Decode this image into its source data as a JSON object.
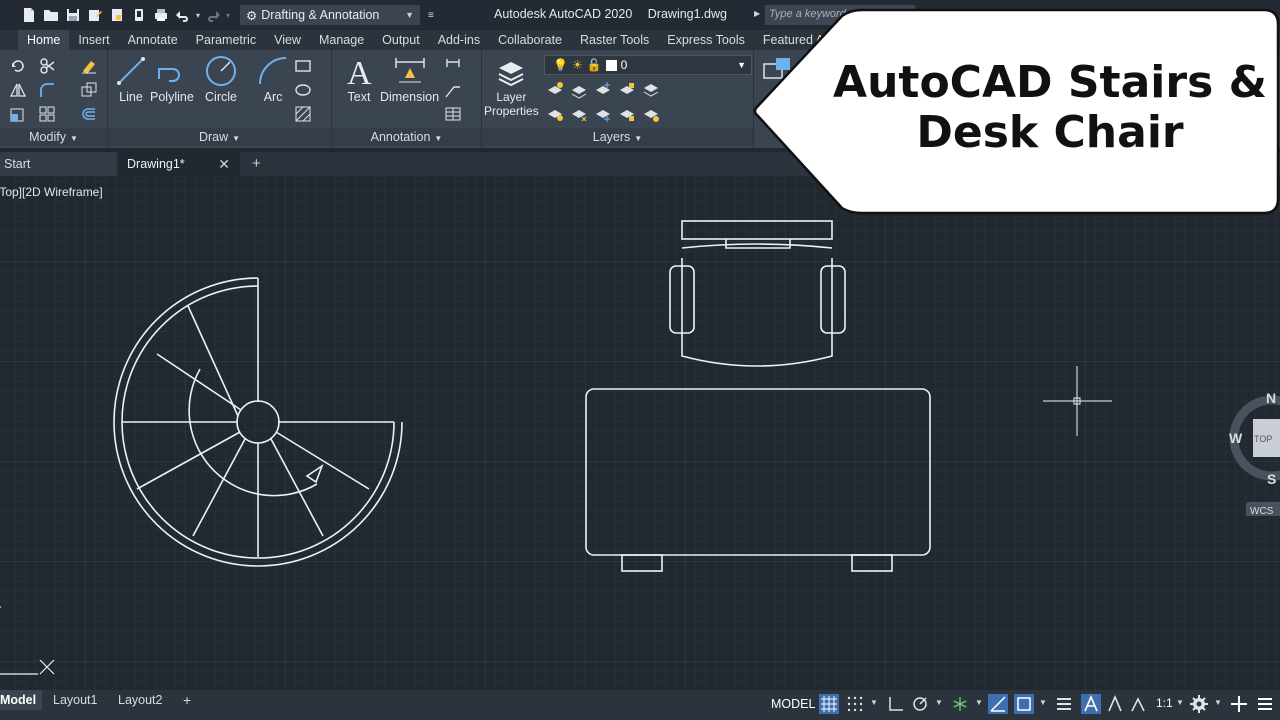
{
  "titlebar": {
    "workspace": "Drafting & Annotation",
    "app_title": "Autodesk AutoCAD 2020",
    "file_name": "Drawing1.dwg",
    "search_placeholder": "Type a keyword or phrase"
  },
  "ribbon_tabs": [
    "Home",
    "Insert",
    "Annotate",
    "Parametric",
    "View",
    "Manage",
    "Output",
    "Add-ins",
    "Collaborate",
    "Raster Tools",
    "Express Tools",
    "Featured Apps"
  ],
  "ribbon": {
    "draw_tools": {
      "line": "Line",
      "polyline": "Polyline",
      "circle": "Circle",
      "arc": "Arc"
    },
    "annotation_tools": {
      "text": "Text",
      "dimension": "Dimension"
    },
    "layer_properties": [
      "Layer",
      "Properties"
    ],
    "layer_combo_value": "0",
    "panels": {
      "modify": "Modify",
      "draw": "Draw",
      "annotation": "Annotation",
      "layers": "Layers"
    }
  },
  "file_tabs": {
    "start": "Start",
    "drawing": "Drawing1*"
  },
  "canvas": {
    "viewport_label": "[Top][2D Wireframe]"
  },
  "viewcube": {
    "north": "N",
    "west": "W",
    "south": "S",
    "face": "TOP",
    "ucs": "WCS"
  },
  "callout": {
    "line1": "AutoCAD Stairs &",
    "line2": "Desk Chair"
  },
  "statusbar": {
    "layout_tabs": [
      "Model",
      "Layout1",
      "Layout2"
    ],
    "model_button": "MODEL",
    "scale": "1:1"
  },
  "colors": {
    "accent": "#3e6fae",
    "canvas": "#212830",
    "ribbon": "#3b4451"
  }
}
